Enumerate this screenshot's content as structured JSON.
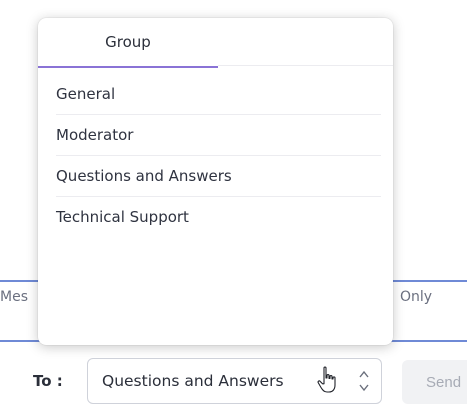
{
  "background": {
    "left_label": "Mes",
    "right_label": "Only"
  },
  "dropdown": {
    "tab_label": "Group",
    "items": [
      "General",
      "Moderator",
      "Questions and Answers",
      "Technical Support"
    ]
  },
  "recipient": {
    "to_label": "To :",
    "selected_value": "Questions and Answers",
    "arrows_icon": "chevron-up-down-icon"
  },
  "send": {
    "label": "Send"
  },
  "colors": {
    "tab_underline": "#8a73d6",
    "rule": "#6f8ad6"
  }
}
